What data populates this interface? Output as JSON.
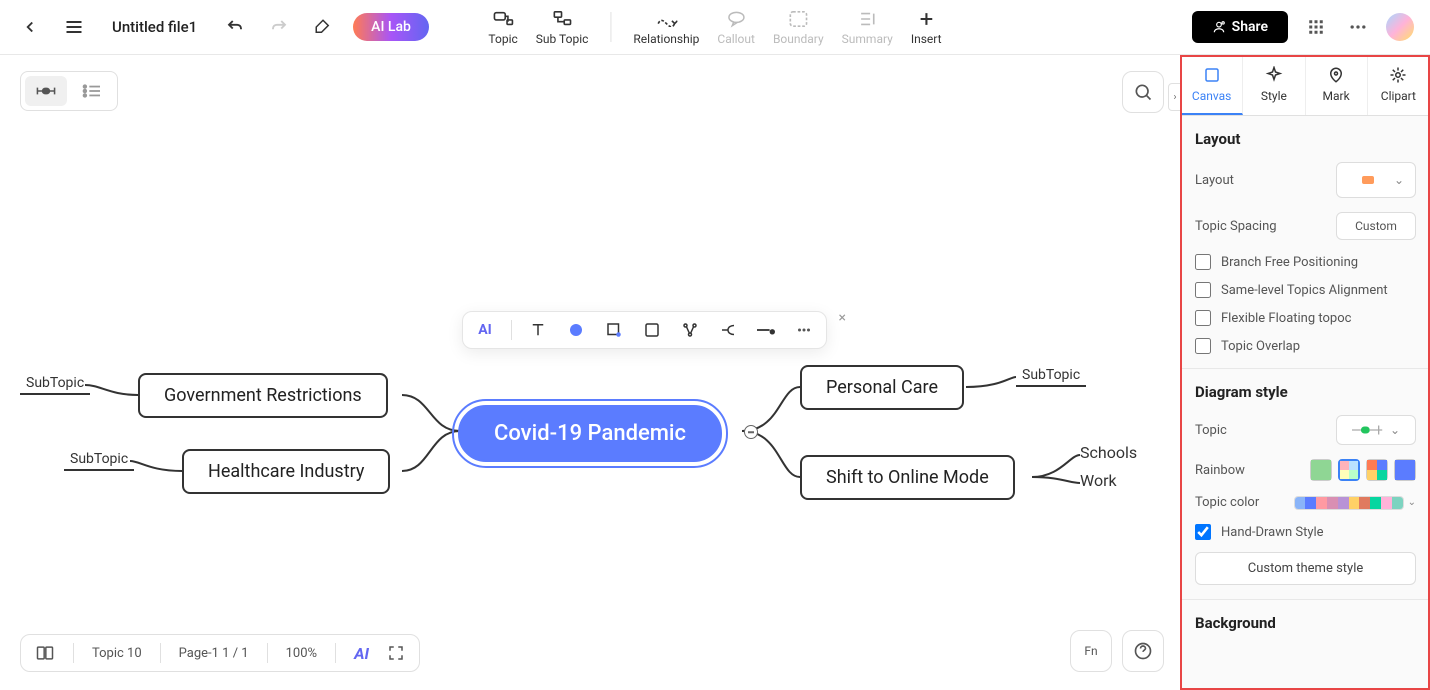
{
  "header": {
    "file_name": "Untitled file1",
    "ai_lab": "AI Lab",
    "share": "Share"
  },
  "tools": {
    "topic": "Topic",
    "subtopic": "Sub Topic",
    "relationship": "Relationship",
    "callout": "Callout",
    "boundary": "Boundary",
    "summary": "Summary",
    "insert": "Insert"
  },
  "mindmap": {
    "central": "Covid-19 Pandemic",
    "left": [
      {
        "main": "Government Restrictions",
        "sub": "SubTopic"
      },
      {
        "main": "Healthcare Industry",
        "sub": "SubTopic"
      }
    ],
    "right": [
      {
        "main": "Personal Care",
        "sub": "SubTopic"
      },
      {
        "main": "Shift to Online Mode",
        "leaves": [
          "Schools",
          "Work"
        ]
      }
    ]
  },
  "float_toolbar": {
    "ai": "AI"
  },
  "bottom": {
    "topic_count": "Topic 10",
    "page": "Page-1  1 / 1",
    "zoom": "100%",
    "ai": "AI",
    "fn": "Fn"
  },
  "panel": {
    "tabs": {
      "canvas": "Canvas",
      "style": "Style",
      "mark": "Mark",
      "clipart": "Clipart"
    },
    "layout": {
      "title": "Layout",
      "layout_label": "Layout",
      "spacing_label": "Topic Spacing",
      "spacing_value": "Custom",
      "branch_free": "Branch Free Positioning",
      "same_level": "Same-level Topics Alignment",
      "flexible": "Flexible Floating topoc",
      "overlap": "Topic Overlap"
    },
    "diagram": {
      "title": "Diagram style",
      "topic_label": "Topic",
      "rainbow_label": "Rainbow",
      "topic_color_label": "Topic color",
      "hand_drawn": "Hand-Drawn Style",
      "custom_theme": "Custom theme style",
      "colors": [
        "#8ab4f8",
        "#5b7cff",
        "#ff9aa2",
        "#d98fb3",
        "#b892d6",
        "#ffd166",
        "#e07a5f",
        "#06d6a0",
        "#ffb3d9",
        "#7dd3c0"
      ]
    },
    "background": {
      "title": "Background"
    }
  },
  "chart_data": {
    "type": "mindmap",
    "title": "Covid-19 Pandemic",
    "root": {
      "label": "Covid-19 Pandemic",
      "children": [
        {
          "label": "Government Restrictions",
          "side": "left",
          "children": [
            {
              "label": "SubTopic"
            }
          ]
        },
        {
          "label": "Healthcare Industry",
          "side": "left",
          "children": [
            {
              "label": "SubTopic"
            }
          ]
        },
        {
          "label": "Personal Care",
          "side": "right",
          "children": [
            {
              "label": "SubTopic"
            }
          ]
        },
        {
          "label": "Shift to Online Mode",
          "side": "right",
          "children": [
            {
              "label": "Schools"
            },
            {
              "label": "Work"
            }
          ]
        }
      ]
    }
  }
}
